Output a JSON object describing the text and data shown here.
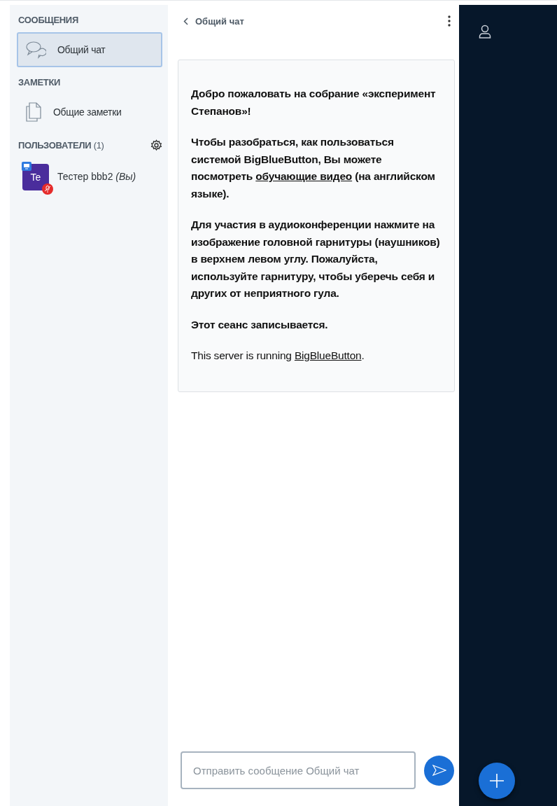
{
  "sidebar": {
    "sections": [
      {
        "title": "СООБЩЕНИЯ",
        "items": [
          {
            "kind": "chat",
            "label": "Общий чат",
            "selected": true
          }
        ]
      },
      {
        "title": "ЗАМЕТКИ",
        "items": [
          {
            "kind": "notes",
            "label": "Общие заметки",
            "selected": false
          }
        ]
      }
    ],
    "users": {
      "title": "ПОЛЬЗОВАТЕЛИ",
      "count": "(1)",
      "list": [
        {
          "initials": "Te",
          "name": "Тестер bbb2",
          "you": "(Вы)",
          "color": "#4a2d9c"
        }
      ]
    }
  },
  "chat": {
    "back_title": "Общий чат",
    "welcome": [
      {
        "bold": true,
        "segments": [
          {
            "kind": "text",
            "text": "Добро пожаловать на собрание «**эксперимент Степанов**»!"
          }
        ]
      },
      {
        "bold": true,
        "segments": [
          {
            "kind": "text",
            "text": "Чтобы разобраться, как пользоваться системой BigBlueButton, Вы можете посмотреть "
          },
          {
            "kind": "link",
            "text": "обучающие видео"
          },
          {
            "kind": "text",
            "text": " (на английском языке)."
          }
        ]
      },
      {
        "bold": true,
        "segments": [
          {
            "kind": "text",
            "text": "Для участия в аудиоконференции нажмите на изображение головной гарнитуры (наушников) в верхнем левом углу. **Пожалуйста, используйте гарнитуру, чтобы уберечь себя и других от неприятного гула.**"
          }
        ]
      },
      {
        "bold": true,
        "segments": [
          {
            "kind": "text",
            "text": "Этот сеанс записывается."
          }
        ]
      },
      {
        "bold": false,
        "segments": [
          {
            "kind": "text",
            "text": "This server is running "
          },
          {
            "kind": "link",
            "text": "BigBlueButton"
          },
          {
            "kind": "text",
            "text": "."
          }
        ]
      }
    ],
    "input": {
      "placeholder": "Отправить сообщение Общий чат"
    }
  }
}
